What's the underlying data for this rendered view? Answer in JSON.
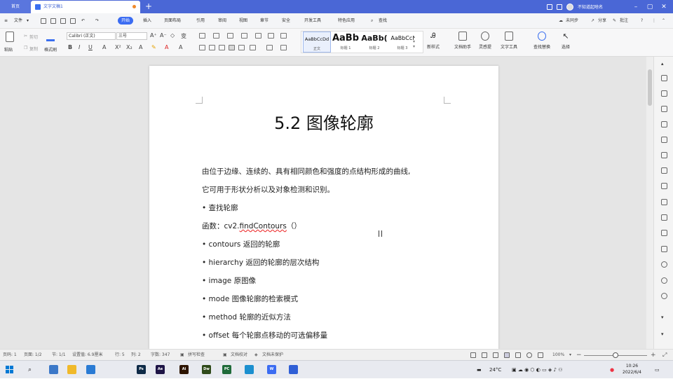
{
  "tabbar": {
    "home": "首页",
    "doc_tab": "文字文稿1",
    "add": "+",
    "user": "不知道起啥名"
  },
  "menu": {
    "file": "文件",
    "items": [
      "开始",
      "插入",
      "页面布局",
      "引用",
      "审阅",
      "视图",
      "章节",
      "安全",
      "开发工具",
      "特色应用"
    ],
    "search": "查找",
    "sync": "未同步",
    "share": "分享",
    "comment": "批注"
  },
  "ribbon": {
    "paste": "粘贴",
    "cut": "剪切",
    "copy": "复制",
    "format_painter": "格式刷",
    "font_name": "Calibri (正文)",
    "font_size": "三号",
    "styles": [
      {
        "sample": "AaBbCcDd",
        "label": "正文"
      },
      {
        "sample": "AaBb",
        "label": "标题 1"
      },
      {
        "sample": "AaBb(",
        "label": "标题 2"
      },
      {
        "sample": "AaBbCcI",
        "label": "标题 3"
      }
    ],
    "new_style": "新样式",
    "doc_assistant": "文档助手",
    "inspiration": "灵感提",
    "text_tools": "文字工具",
    "find_replace": "查找替换",
    "select": "选择"
  },
  "document": {
    "title": "5.2  图像轮廓",
    "intro_line1": "由位于边缘、连续的、具有相同颜色和强度的点结构形成的曲线,",
    "intro_line2": "它可用于形状分析以及对象检测和识别。",
    "bullet_find": "查找轮廓",
    "func_prefix": "函数：cv2.",
    "func_name": "findContours",
    "func_suffix": "（）",
    "params": [
      {
        "name": "contours",
        "desc": "返回的轮廓"
      },
      {
        "name": "hierarchy",
        "desc": "返回的轮廓的层次结构"
      },
      {
        "name": "image",
        "desc": "原图像"
      },
      {
        "name": "mode",
        "desc": "图像轮廓的检索模式"
      },
      {
        "name": "method",
        "desc": "轮廓的近似方法"
      },
      {
        "name": "offset",
        "desc": "每个轮廓点移动的可选偏移量"
      }
    ]
  },
  "status": {
    "page_no": "页码: 1",
    "page": "页面: 1/2",
    "section": "节: 1/1",
    "setting": "设置值: 6.9厘米",
    "row": "行: 5",
    "col": "列: 2",
    "words": "字数: 347",
    "spell": "拼写检查",
    "proof": "文档校对",
    "protect": "文档未保护",
    "zoom": "100%"
  },
  "taskbar": {
    "apps": [
      {
        "name": "folder",
        "color": "#3b78c8",
        "text": ""
      },
      {
        "name": "explorer",
        "color": "#f0b92a",
        "text": ""
      },
      {
        "name": "files",
        "color": "#2a7bd4",
        "text": ""
      },
      {
        "name": "photoshop",
        "color": "#0e2a47",
        "text": "Ps"
      },
      {
        "name": "after-effects",
        "color": "#1e1446",
        "text": "Ae"
      },
      {
        "name": "illustrator",
        "color": "#2d1400",
        "text": "Ai"
      },
      {
        "name": "dreamweaver",
        "color": "#2f4a1a",
        "text": "Dw"
      },
      {
        "name": "pycharm",
        "color": "#1f6b3a",
        "text": "PC"
      },
      {
        "name": "edge",
        "color": "#1b8fcf",
        "text": ""
      },
      {
        "name": "wps",
        "color": "#3b6cf2",
        "text": "W"
      },
      {
        "name": "app",
        "color": "#2f5fd6",
        "text": ""
      }
    ],
    "temp": "24°C",
    "lang": "中",
    "time": "10:26",
    "date": "2022/6/4"
  }
}
